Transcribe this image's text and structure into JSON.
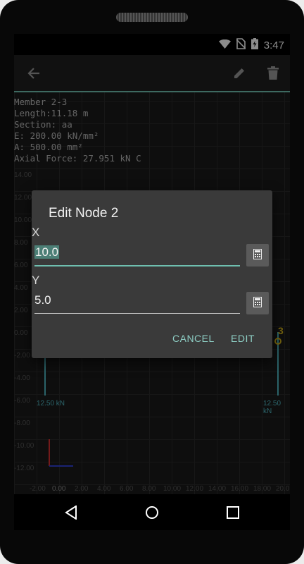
{
  "status": {
    "time": "3:47",
    "icons": [
      "wifi-icon",
      "no-sim-icon",
      "battery-charging-icon"
    ]
  },
  "toolbar": {
    "back_icon": "arrow-back-icon",
    "edit_icon": "pencil-icon",
    "delete_icon": "trash-icon"
  },
  "member_info": {
    "line1": "Member 2-3",
    "line2": "Length:11.18 m",
    "line3": "Section: aa",
    "line4": "E: 200.00 kN/mm²",
    "line5": "A: 500.00 mm²",
    "line6": "Axial Force: 27.951 kN C"
  },
  "canvas": {
    "y_ticks": [
      "14.00",
      "12.00",
      "10.00",
      "8.00",
      "6.00",
      "4.00",
      "2.00",
      "0.00",
      "-2.00",
      "-4.00",
      "-6.00",
      "-8.00",
      "-10.00",
      "-12.00"
    ],
    "x_ticks": [
      "-2.00",
      "0.00",
      "2.00",
      "4.00",
      "6.00",
      "8.00",
      "10.00",
      "12.00",
      "14.00",
      "16.00",
      "18.00",
      "20.0"
    ],
    "force_left": "12.50 kN",
    "force_right": "12.50 kN",
    "node_label": "3",
    "colors": {
      "force": "#4fb6c2",
      "node": "#d4b21a",
      "accent": "#6fbfb0"
    }
  },
  "dialog": {
    "title": "Edit Node 2",
    "x_label": "X",
    "x_value": "10.0",
    "y_label": "Y",
    "y_value": "5.0",
    "calc_icon": "calculator-icon",
    "cancel_label": "CANCEL",
    "edit_label": "EDIT"
  },
  "navbar": {
    "back_icon": "nav-back-icon",
    "home_icon": "nav-home-icon",
    "recents_icon": "nav-recents-icon"
  }
}
